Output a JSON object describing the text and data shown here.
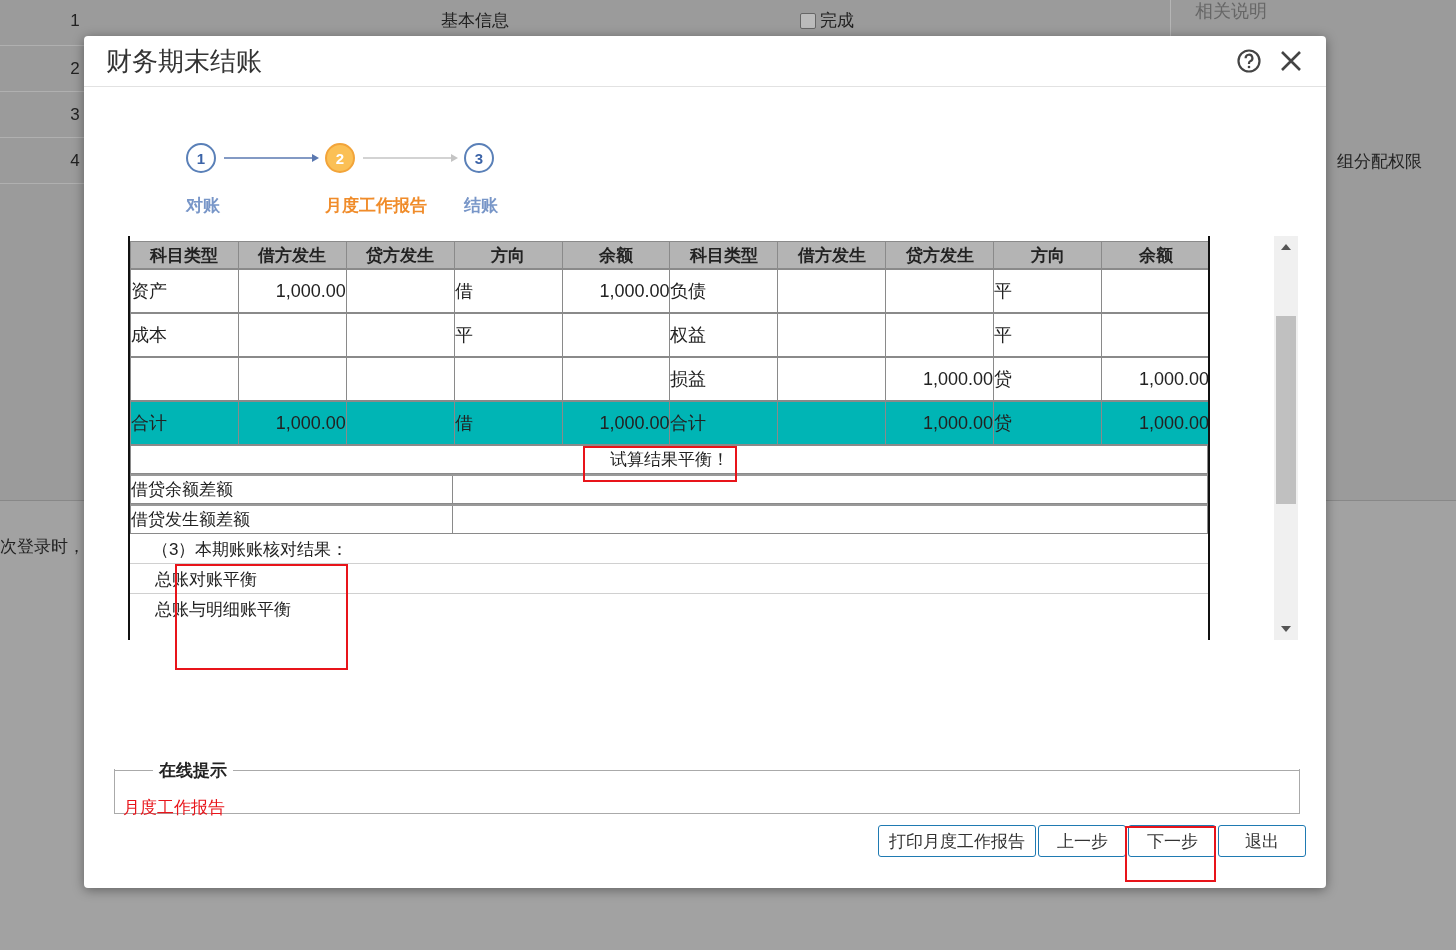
{
  "background": {
    "rows": [
      {
        "number": "1",
        "title": "基本信息",
        "checkbox": {
          "label": "完成",
          "checked": false
        }
      },
      {
        "number": "2"
      },
      {
        "number": "3"
      },
      {
        "number": "4"
      }
    ],
    "side_title": "相关说明",
    "side_text": "组分配权限",
    "note_text": "次登录时，"
  },
  "dialog": {
    "title": "财务期末结账",
    "steps": [
      {
        "number": "1",
        "label": "对账",
        "selected": false
      },
      {
        "number": "2",
        "label": "月度工作报告",
        "selected": true
      },
      {
        "number": "3",
        "label": "结账",
        "selected": false
      }
    ],
    "table": {
      "columns": [
        "科目类型",
        "借方发生",
        "贷方发生",
        "方向",
        "余额",
        "科目类型",
        "借方发生",
        "贷方发生",
        "方向",
        "余额"
      ],
      "rows": [
        {
          "kind": "data",
          "cells": [
            "资产",
            "1,000.00",
            null,
            "借",
            "1,000.00",
            "负债",
            null,
            null,
            "平",
            null
          ]
        },
        {
          "kind": "data",
          "cells": [
            "成本",
            null,
            null,
            "平",
            null,
            "权益",
            null,
            null,
            "平",
            null
          ]
        },
        {
          "kind": "data",
          "cells": [
            null,
            null,
            null,
            null,
            null,
            "损益",
            null,
            "1,000.00",
            "贷",
            "1,000.00"
          ]
        },
        {
          "kind": "total",
          "cells": [
            "合计",
            "1,000.00",
            null,
            "借",
            "1,000.00",
            "合计",
            null,
            "1,000.00",
            "贷",
            "1,000.00"
          ]
        }
      ],
      "result": "试算结果平衡！",
      "differences": [
        "借贷余额差额",
        "借贷发生额差额"
      ],
      "checks": [
        {
          "kind": "heading",
          "text": "（3）本期账账核对结果："
        },
        {
          "kind": "item",
          "text": "总账对账平衡"
        },
        {
          "kind": "item",
          "text": "总账与明细账平衡"
        }
      ]
    },
    "hint": {
      "legend": "在线提示",
      "text": "月度工作报告"
    },
    "buttons": [
      "打印月度工作报告",
      "上一步",
      "下一步",
      "退出"
    ]
  }
}
